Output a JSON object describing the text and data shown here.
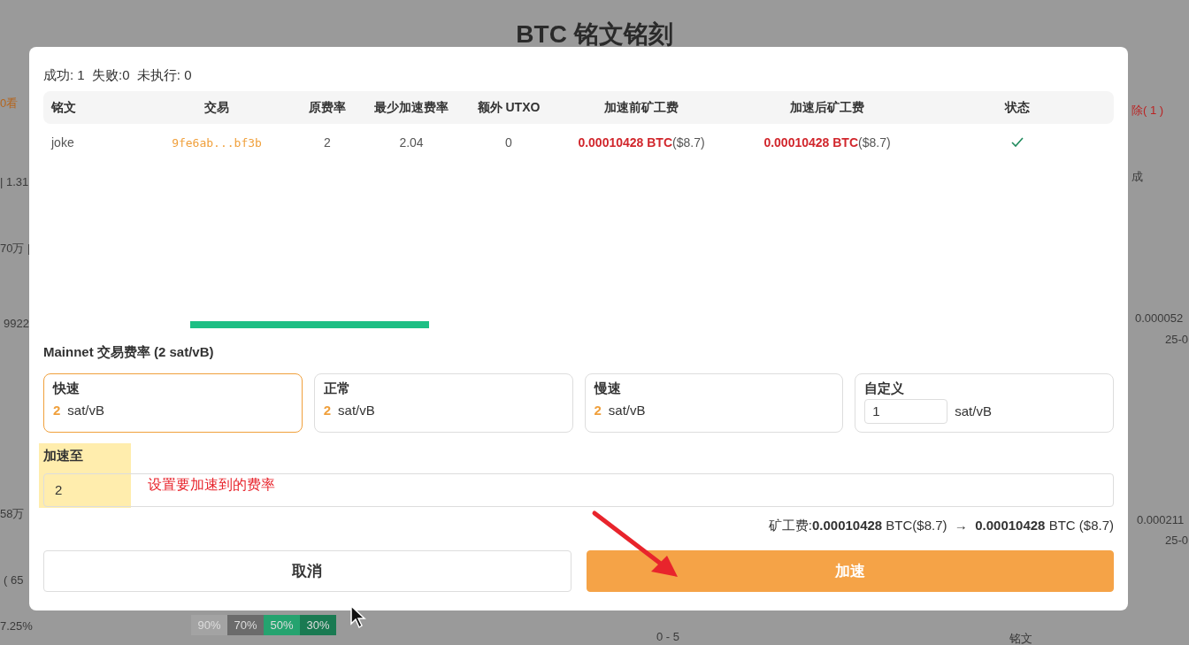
{
  "page": {
    "title": "BTC 铭文铭刻",
    "fragments": [
      {
        "kind": "left",
        "text": "0看"
      },
      {
        "kind": "left",
        "text": "| 1.31"
      },
      {
        "kind": "left",
        "text": "70万 |"
      },
      {
        "kind": "left",
        "text": "9922"
      },
      {
        "kind": "left",
        "text": "58万"
      },
      {
        "kind": "left",
        "text": "( 65"
      },
      {
        "kind": "left",
        "text": "7.25%"
      },
      {
        "kind": "right",
        "text": "除( 1 )"
      },
      {
        "kind": "right",
        "text": "成"
      },
      {
        "kind": "right",
        "text": "0.000052"
      },
      {
        "kind": "right",
        "text": "25-0"
      },
      {
        "kind": "right",
        "text": "0.000211"
      },
      {
        "kind": "right",
        "text": "25-0"
      },
      {
        "kind": "bottom",
        "text": "0 - 5"
      },
      {
        "kind": "bottom",
        "text": "铭文"
      }
    ],
    "legend": [
      {
        "text": "90%",
        "color": "#a3a3a3"
      },
      {
        "text": "70%",
        "color": "#6b6b6b"
      },
      {
        "text": "50%",
        "color": "#25a36f"
      },
      {
        "text": "30%",
        "color": "#1a7a52"
      }
    ]
  },
  "dialog": {
    "summary": "成功: 1  失败:0  未执行: 0",
    "table": {
      "columns": [
        "铭文",
        "交易",
        "原费率",
        "最少加速费率",
        "额外 UTXO",
        "加速前矿工费",
        "加速后矿工费",
        "状态"
      ],
      "rows": [
        {
          "inscription": "joke",
          "tx": "9fe6ab...bf3b",
          "orig_rate": "2",
          "min_rate": "2.04",
          "extra_utxo": "0",
          "fee_before": "0.00010428 BTC",
          "fee_before_usd": "($8.7)",
          "fee_after": "0.00010428 BTC",
          "fee_after_usd": "($8.7)",
          "success": true
        }
      ]
    },
    "fee_title": "Mainnet 交易费率 (2 sat/vB)",
    "fee_rates": [
      {
        "kind": "preset",
        "label": "快速",
        "value": "2",
        "unit": "sat/vB",
        "selected": true
      },
      {
        "kind": "preset",
        "label": "正常",
        "value": "2",
        "unit": "sat/vB",
        "selected": false
      },
      {
        "kind": "preset",
        "label": "慢速",
        "value": "2",
        "unit": "sat/vB",
        "selected": false
      },
      {
        "kind": "custom",
        "label": "自定义",
        "value": "1",
        "unit": "sat/vB",
        "selected": false
      }
    ],
    "accelerate_label": "加速至",
    "accelerate_value": "2",
    "annotation": "设置要加速到的费率",
    "fee_summary": "矿工费:**0.00010428** BTC($8.7)  →  **0.00010428** BTC ($8.7)",
    "buttons": [
      {
        "kind": "cancel",
        "label": "取消"
      },
      {
        "kind": "primary",
        "label": "加速"
      }
    ]
  }
}
